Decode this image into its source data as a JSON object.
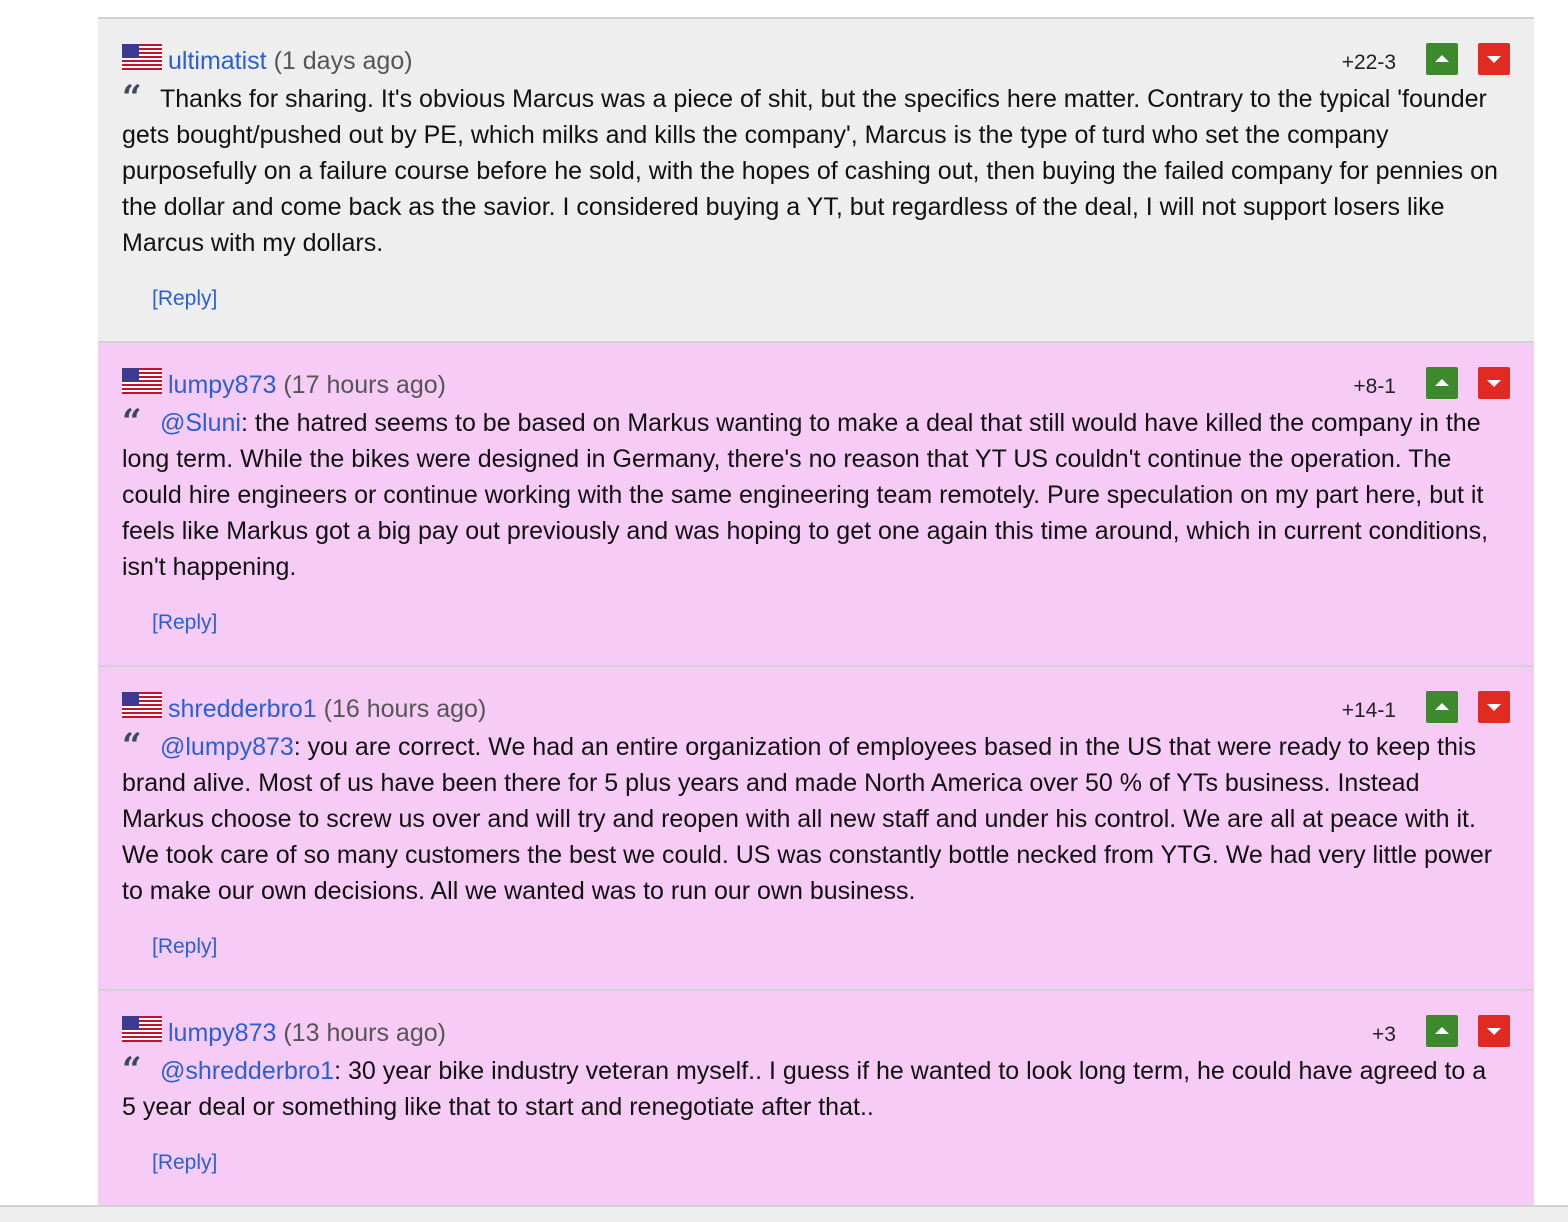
{
  "comments": [
    {
      "author": "ultimatist",
      "age": "(1 days ago)",
      "score": "+22-3",
      "mention": "",
      "mention_sep": "",
      "text": "Thanks for sharing. It's obvious Marcus was a piece of shit, but the specifics here matter. Contrary to the typical 'founder gets bought/pushed out by PE, which milks and kills the company', Marcus is the type of turd who set the company purposefully on a failure course before he sold, with the hopes of cashing out, then buying the failed company for pennies on the dollar and come back as the savior. I considered buying a YT, but regardless of the deal, I will not support losers like Marcus with my dollars.",
      "reply": "[Reply]"
    },
    {
      "author": "lumpy873",
      "age": "(17 hours ago)",
      "score": "+8-1",
      "mention": "@Sluni",
      "mention_sep": ":",
      "text": " the hatred seems to be based on Markus wanting to make a deal that still would have killed the company in the long term. While the bikes were designed in Germany, there's no reason that YT US couldn't continue the operation. The could hire engineers or continue working with the same engineering team remotely. Pure speculation on my part here, but it feels like Markus got a big pay out previously and was hoping to get one again this time around, which in current conditions, isn't happening.",
      "reply": "[Reply]"
    },
    {
      "author": "shredderbro1",
      "age": "(16 hours ago)",
      "score": "+14-1",
      "mention": "@lumpy873",
      "mention_sep": ":",
      "text": " you are correct. We had an entire organization of employees based in the US that were ready to keep this brand alive. Most of us have been there for 5 plus years and made North America over 50 % of YTs business. Instead Markus choose to screw us over and will try and reopen with all new staff and under his control. We are all at peace with it. We took care of so many customers the best we could. US was constantly bottle necked from YTG. We had very little power to make our own decisions. All we wanted was to run our own business.",
      "reply": "[Reply]"
    },
    {
      "author": "lumpy873",
      "age": "(13 hours ago)",
      "score": "+3",
      "mention": "@shredderbro1",
      "mention_sep": ":",
      "text": " 30 year bike industry veteran myself.. I guess if he wanted to look long term, he could have agreed to a 5 year deal or something like that to start and renegotiate after that..",
      "reply": "[Reply]"
    }
  ],
  "icons": {
    "flag": "us-flag-icon",
    "quote": "quote-icon",
    "upvote": "upvote-arrow-icon",
    "downvote": "downvote-arrow-icon"
  },
  "colors": {
    "link": "#2a5fd4",
    "upvote": "#3c8a2c",
    "downvote": "#e02a22",
    "own_comment_bg": "#eeeeee",
    "reply_bg": "#f6ccf6"
  }
}
